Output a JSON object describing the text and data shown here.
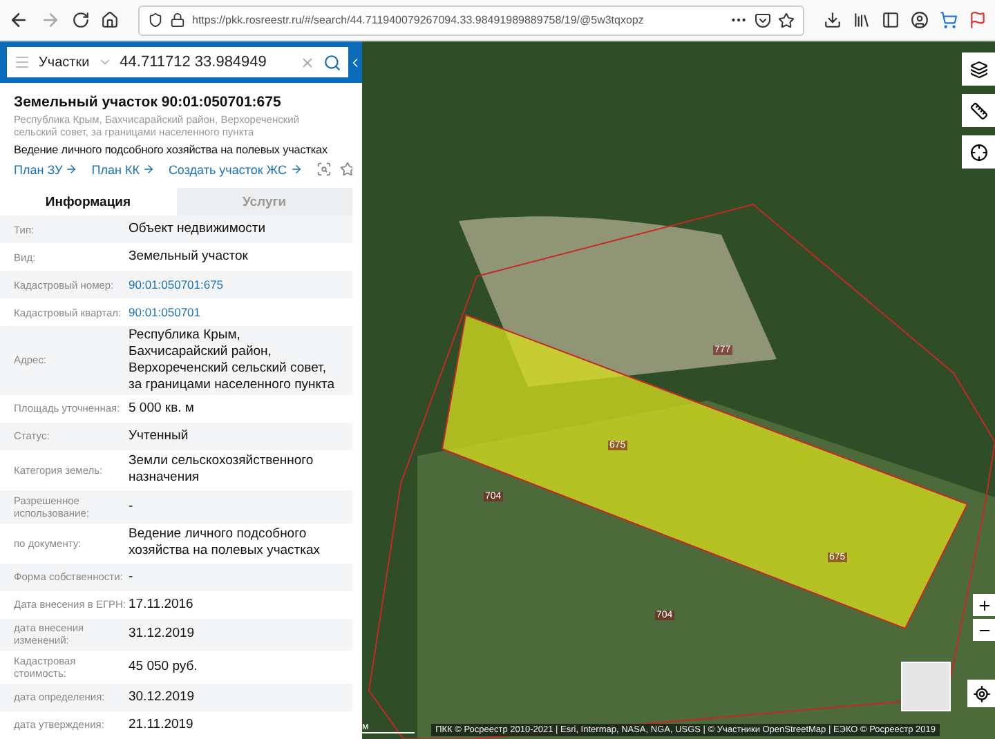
{
  "browser": {
    "url": "https://pkk.rosreestr.ru/#/search/44.711940079267094.33.98491989889758/19/@5w3tqxopz"
  },
  "search": {
    "category": "Участки",
    "query": "44.711712 33.984949"
  },
  "parcel": {
    "title": "Земельный участок 90:01:050701:675",
    "address": "Республика Крым, Бахчисарайский район, Верхореченский сельский совет, за границами населенного пункта",
    "purpose": "Ведение личного подсобного хозяйства на полевых участках",
    "links": [
      "План ЗУ",
      "План КК",
      "Создать участок ЖС"
    ]
  },
  "tabs": [
    {
      "label": "Информация",
      "selected": true
    },
    {
      "label": "Услуги",
      "selected": false
    }
  ],
  "rows": [
    {
      "label": "Тип:",
      "value": "Объект недвижимости",
      "kind": "text"
    },
    {
      "label": "Вид:",
      "value": "Земельный участок",
      "kind": "text"
    },
    {
      "label": "Кадастровый номер:",
      "value": "90:01:050701:675",
      "kind": "link"
    },
    {
      "label": "Кадастровый квартал:",
      "value": "90:01:050701",
      "kind": "link"
    },
    {
      "label": "Адрес:",
      "value": "Республика Крым, Бахчисарайский район, Верхореченский сельский совет, за границами населенного пункта",
      "kind": "text"
    },
    {
      "label": "Площадь уточненная:",
      "value": "5 000 кв. м",
      "kind": "text"
    },
    {
      "label": "Статус:",
      "value": "Учтенный",
      "kind": "text"
    },
    {
      "label": "Категория земель:",
      "value": "Земли сельскохозяйственного назначения",
      "kind": "text"
    },
    {
      "label": "Разрешенное использование:",
      "value": "-",
      "kind": "text"
    },
    {
      "label": "по документу:",
      "value": "Ведение личного подсобного хозяйства на полевых участках",
      "kind": "text"
    },
    {
      "label": "Форма собственности:",
      "value": "-",
      "kind": "text"
    },
    {
      "label": "Дата внесения в ЕГРН:",
      "value": "17.11.2016",
      "kind": "text"
    },
    {
      "label": "дата внесения изменений:",
      "value": "31.12.2019",
      "kind": "text"
    },
    {
      "label": "Кадастровая стоимость:",
      "value": "45 050 руб.",
      "kind": "text"
    },
    {
      "label": "дата определения:",
      "value": "30.12.2019",
      "kind": "text"
    },
    {
      "label": "дата утверждения:",
      "value": "21.11.2019",
      "kind": "text"
    }
  ],
  "map": {
    "labels": [
      "777",
      "675",
      "704",
      "675",
      "704"
    ],
    "scale": "м",
    "attribution": "ПКК © Росреестр 2010-2021 | Esri, Intermap, NASA, NGA, USGS | © Участники OpenStreetMap | ЕЭКО © Росреестр 2019"
  }
}
